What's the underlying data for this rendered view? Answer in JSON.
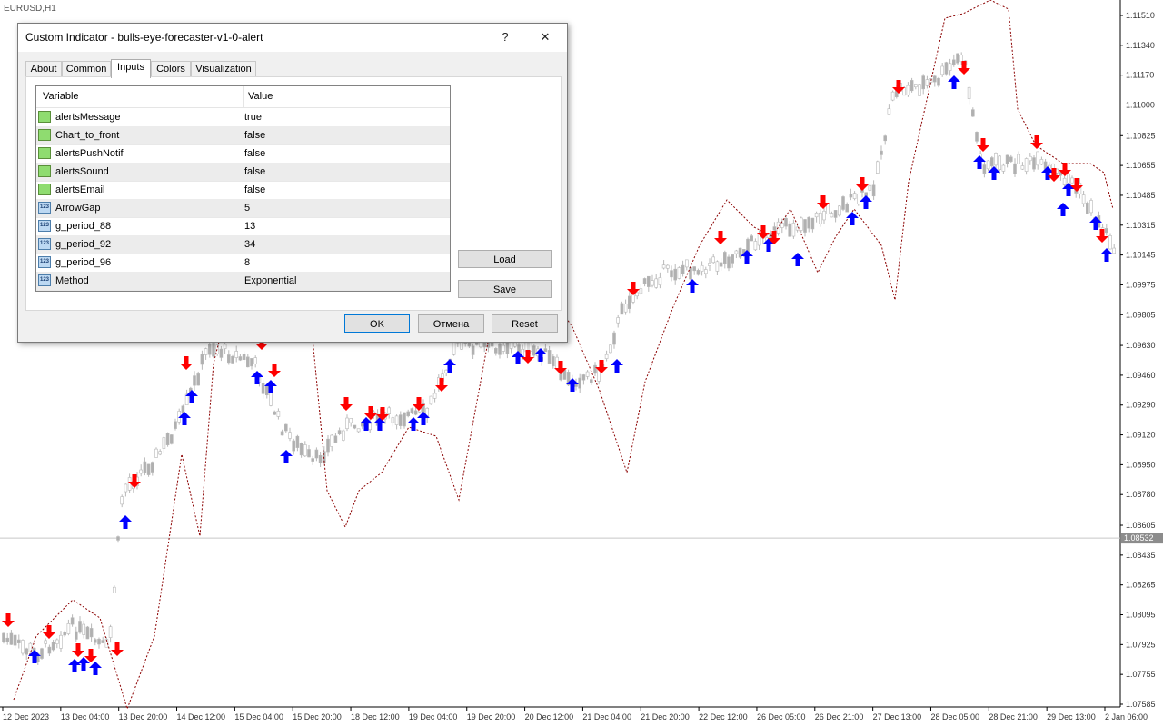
{
  "chart": {
    "symbol": "EURUSD,H1",
    "price_labels": [
      "1.11510",
      "1.11340",
      "1.11170",
      "1.11000",
      "1.10825",
      "1.10655",
      "1.10485",
      "1.10315",
      "1.10145",
      "1.09975",
      "1.09805",
      "1.09630",
      "1.09460",
      "1.09290",
      "1.09120",
      "1.08950",
      "1.08780",
      "1.08605",
      "1.08435",
      "1.08265",
      "1.08095",
      "1.07925",
      "1.07755",
      "1.07585"
    ],
    "price_top": 1.1151,
    "price_bottom": 1.07585,
    "current_price": "1.08532",
    "current_price_value": 1.08532,
    "date_labels": [
      "12 Dec 2023",
      "13 Dec 04:00",
      "13 Dec 20:00",
      "14 Dec 12:00",
      "15 Dec 04:00",
      "15 Dec 20:00",
      "18 Dec 12:00",
      "19 Dec 04:00",
      "19 Dec 20:00",
      "20 Dec 12:00",
      "21 Dec 04:00",
      "21 Dec 20:00",
      "22 Dec 12:00",
      "26 Dec 05:00",
      "26 Dec 21:00",
      "27 Dec 13:00",
      "28 Dec 05:00",
      "28 Dec 21:00",
      "29 Dec 13:00",
      "2 Jan 06:00"
    ],
    "colors": {
      "up_arrow": "#0000ff",
      "down_arrow": "#ff0000",
      "line": "#8b0000",
      "candle": "#b8b8b8"
    }
  },
  "dialog": {
    "title": "Custom Indicator - bulls-eye-forecaster-v1-0-alert",
    "help": "?",
    "close": "✕",
    "tabs": [
      "About",
      "Common",
      "Inputs",
      "Colors",
      "Visualization"
    ],
    "active_tab": "Inputs",
    "columns": {
      "variable": "Variable",
      "value": "Value"
    },
    "rows": [
      {
        "name": "alertsMessage",
        "value": "true",
        "type": "bool"
      },
      {
        "name": "Chart_to_front",
        "value": "false",
        "type": "bool"
      },
      {
        "name": "alertsPushNotif",
        "value": "false",
        "type": "bool"
      },
      {
        "name": "alertsSound",
        "value": "false",
        "type": "bool"
      },
      {
        "name": "alertsEmail",
        "value": "false",
        "type": "bool"
      },
      {
        "name": "ArrowGap",
        "value": "5",
        "type": "num"
      },
      {
        "name": "g_period_88",
        "value": "13",
        "type": "num"
      },
      {
        "name": "g_period_92",
        "value": "34",
        "type": "num"
      },
      {
        "name": "g_period_96",
        "value": "8",
        "type": "num"
      },
      {
        "name": "Method",
        "value": "Exponential",
        "type": "num"
      }
    ],
    "num_icon_text": "123",
    "load": "Load",
    "save": "Save",
    "ok": "OK",
    "cancel": "Отмена",
    "reset": "Reset"
  }
}
